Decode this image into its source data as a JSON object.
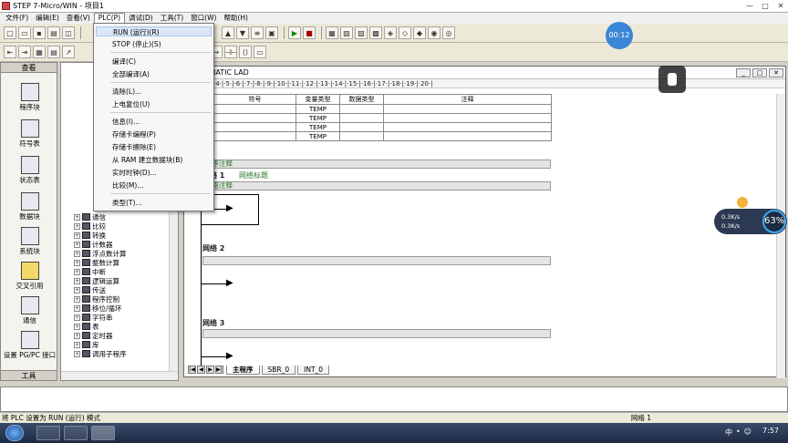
{
  "window": {
    "title": "STEP 7-Micro/WIN - 项目1",
    "min": "—",
    "max": "□",
    "close": "✕"
  },
  "menu": [
    "文件(F)",
    "编辑(E)",
    "查看(V)",
    "PLC(P)",
    "调试(D)",
    "工具(T)",
    "窗口(W)",
    "帮助(H)"
  ],
  "plc_menu": {
    "run": "RUN (运行)(R)",
    "stop": "STOP (停止)(S)",
    "compile": "编译(C)",
    "compile_all": "全部编译(A)",
    "clear": "清除(L)...",
    "power_reset": "上电复位(U)",
    "info": "信息(I)...",
    "card_prog": "存储卡编程(P)",
    "card_erase": "存储卡擦除(E)",
    "ram_to_db": "从 RAM 建立数据块(B)",
    "rtc": "实时时钟(D)...",
    "compare": "比较(M)...",
    "type": "类型(T)..."
  },
  "left_panel": {
    "header": "查看",
    "footer": "工具",
    "items": [
      "程序块",
      "符号表",
      "状态表",
      "数据块",
      "系统块",
      "交叉引用",
      "通信",
      "设置 PG/PC 接口"
    ]
  },
  "tree": {
    "items": [
      "通信",
      "比较",
      "转换",
      "计数器",
      "浮点数计算",
      "整数计算",
      "中断",
      "逻辑运算",
      "传送",
      "程序控制",
      "移位/循环",
      "字符串",
      "表",
      "定时器",
      "库",
      "调用子程序"
    ]
  },
  "editor": {
    "title": "SIMATIC LAD",
    "ruler": "·4·|·5·|·6·|·7·|·8·|·9·|·10·|·11·|·12·|·13·|·14·|·15·|·16·|·17·|·18·|·19·|·20·|",
    "var_headers": [
      "符号",
      "变量类型",
      "数据类型",
      "注释"
    ],
    "var_rows": [
      "TEMP",
      "TEMP",
      "TEMP",
      "TEMP"
    ],
    "prog_comment": "程序注释",
    "network1_label": "网络 1",
    "network1_title": "网络标题",
    "network_comment": "网络注释",
    "network2_label": "网络 2",
    "network3_label": "网络 3",
    "tabs": [
      "主程序",
      "SBR_0",
      "INT_0"
    ]
  },
  "status": {
    "text": "将 PLC 设置为 RUN (运行) 模式",
    "right": "网络 1"
  },
  "overlay": {
    "timer": "00:12",
    "up": "0.3K/s",
    "down": "0.3K/s",
    "percent": "63%"
  },
  "taskbar": {
    "clock": "7:57",
    "tray": [
      "中",
      "•",
      "☺"
    ]
  }
}
